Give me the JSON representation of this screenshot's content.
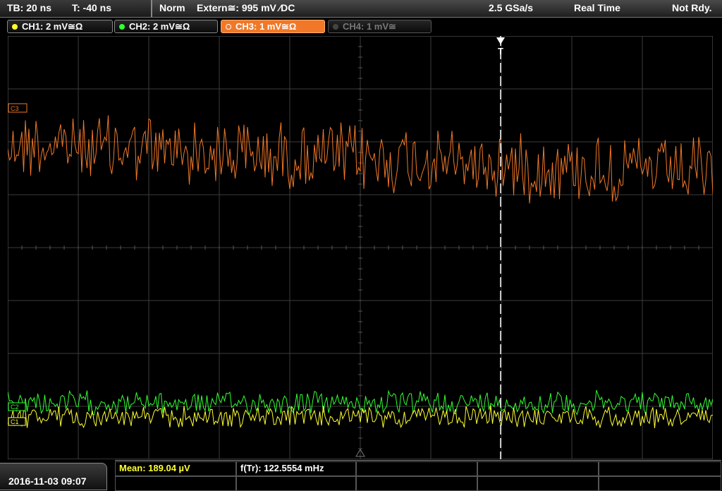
{
  "topbar": {
    "timebase": "TB: 20 ns",
    "trigger_offset": "T: -40 ns",
    "mode": "Norm",
    "trigger_source": "Extern≅: 995 mV ⁄DC",
    "sample_rate": "2.5 GSa/s",
    "acquisition": "Real Time",
    "status": "Not Rdy."
  },
  "channels": [
    {
      "label": "CH1: 2 mV≅Ω",
      "color": "#ffff30",
      "state": "on"
    },
    {
      "label": "CH2: 2 mV≅Ω",
      "color": "#30ff30",
      "state": "on"
    },
    {
      "label": "CH3: 1 mV≅Ω",
      "color": "#f07828",
      "state": "active"
    },
    {
      "label": "CH4: 1 mV≅",
      "color": "#777777",
      "state": "off"
    }
  ],
  "markers": {
    "ch3": "C3",
    "ch1": "C1",
    "ch2": "C2",
    "trigger": "T"
  },
  "colors": {
    "ch1": "#ffff30",
    "ch2": "#30ff30",
    "ch3": "#f07828",
    "grid": "#3c3c3c"
  },
  "status_bar": {
    "datetime": "2016-11-03 09:07",
    "mean_label": "Mean: 189.04 µV",
    "freq_label": "f(Tr): 122.5554 mHz"
  }
}
